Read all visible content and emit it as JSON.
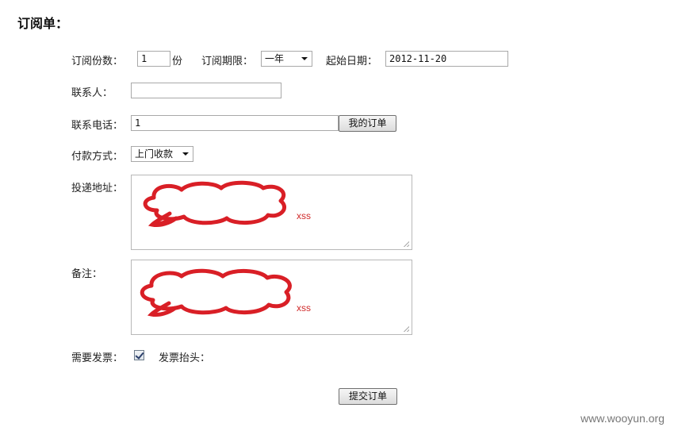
{
  "page": {
    "title": "订阅单："
  },
  "form": {
    "copies_label": "订阅份数：",
    "copies_value": "1",
    "copies_unit": "份",
    "period_label": "订阅期限：",
    "period_value": "一年",
    "start_date_label": "起始日期：",
    "start_date_value": "2012-11-20",
    "contact_label": "联系人：",
    "contact_value": "",
    "phone_label": "联系电话：",
    "phone_value": "1",
    "my_orders_button": "我的订单",
    "payment_label": "付款方式：",
    "payment_value": "上门收款",
    "address_label": "投递地址：",
    "address_value": "xss",
    "note_label": "备注：",
    "note_value": "xss",
    "invoice_label": "需要发票：",
    "invoice_checked": true,
    "invoice_title_label": "发票抬头：",
    "submit_button": "提交订单"
  },
  "annotation_color": "#d91f26",
  "watermark": "www.wooyun.org"
}
